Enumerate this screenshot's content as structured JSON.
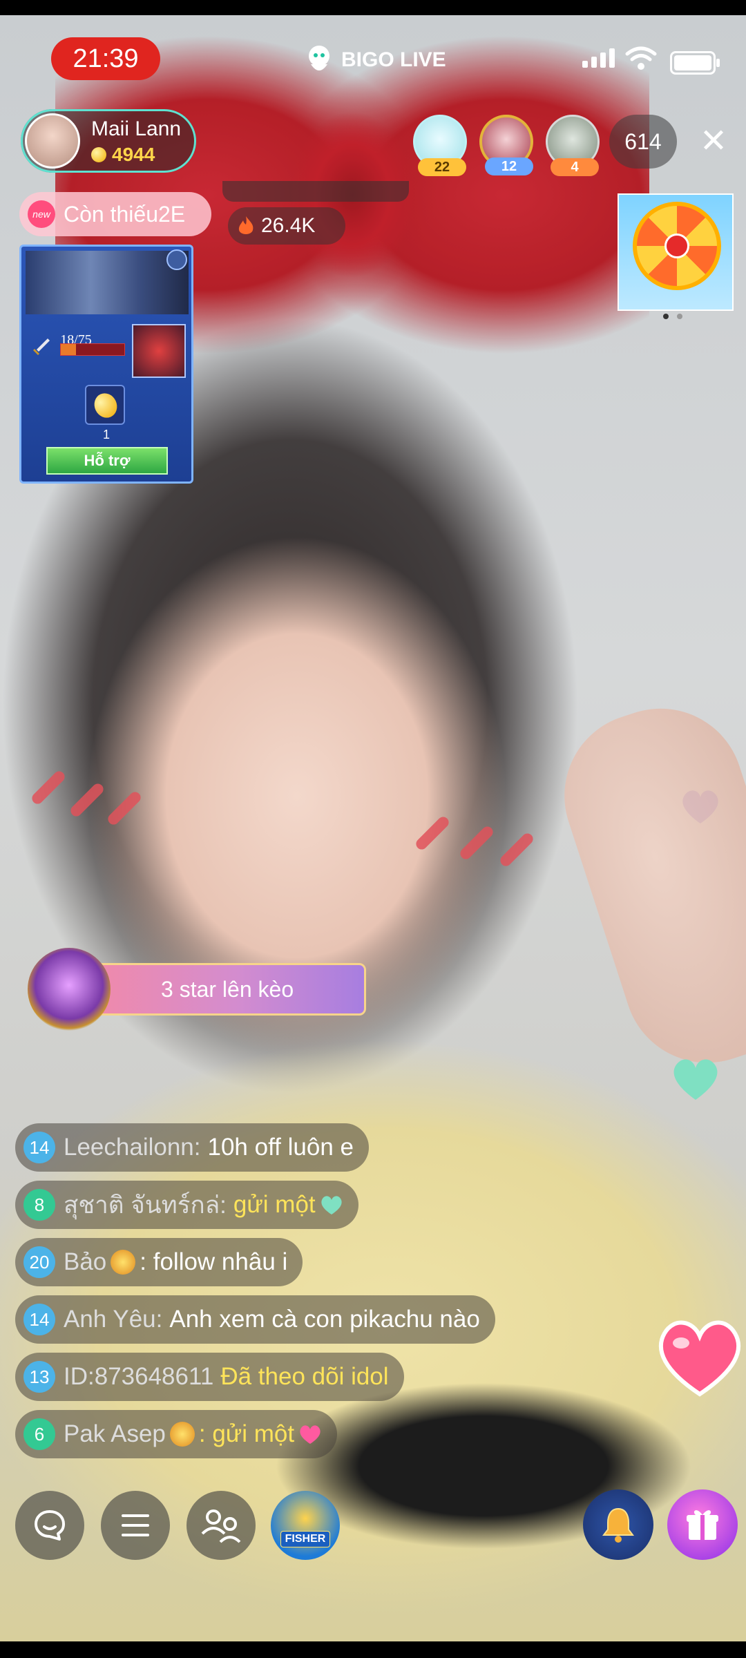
{
  "app": {
    "brand": "BIGO LIVE"
  },
  "status_bar": {
    "time": "21:39"
  },
  "host": {
    "name": "Maii Lann",
    "beans": "4944"
  },
  "mission": {
    "badge": "new",
    "text": "Còn thiếu2E"
  },
  "stats": {
    "heat": "26.4K"
  },
  "viewers": [
    {
      "level": "22"
    },
    {
      "level": "12"
    },
    {
      "level": "4"
    }
  ],
  "viewer_count": "614",
  "game_widget": {
    "progress_text": "18/75",
    "progress": 0.24,
    "item_qty": "1",
    "help_label": "Hỗ trợ"
  },
  "banner": {
    "text": "3 star lên kèo"
  },
  "chat": [
    {
      "level": "14",
      "level_color": "blue",
      "user": "Leechailonn:",
      "text": "10h off luôn e",
      "text_style": "white"
    },
    {
      "level": "8",
      "level_color": "green",
      "user": "สุชาติ จันทร์กล่:",
      "text": "gửi một",
      "text_style": "gold",
      "icon": "mint-heart-icon"
    },
    {
      "level": "20",
      "level_color": "blue",
      "user": "Bảo",
      "badge": "shield-badge-icon",
      "text": ": follow nhâu i",
      "text_style": "white"
    },
    {
      "level": "14",
      "level_color": "blue",
      "user": "Anh Yêu:",
      "text": "Anh xem cà con pikachu nào",
      "text_style": "white"
    },
    {
      "level": "13",
      "level_color": "blue",
      "user": "ID:873648611",
      "text": "Đã theo dõi idol",
      "text_style": "gold"
    },
    {
      "level": "6",
      "level_color": "green",
      "user": "Pak Asep",
      "badge": "star-badge-icon",
      "text": ": gửi một",
      "text_style": "gold",
      "icon": "pink-heart-icon"
    }
  ],
  "colors": {
    "live_red": "#e0251f",
    "mint": "#5fe1d0",
    "gold_text": "#ffe45a",
    "level_blue": "#4cb3e8",
    "level_green": "#33c993"
  },
  "icons": {
    "chat_button": "chat-bubble-icon",
    "menu_button": "menu-icon",
    "multi_guest_button": "people-icon",
    "fisher_game": "FISHER",
    "bell_button": "bell-icon",
    "gift_button": "gift-icon",
    "like_button": "heart-icon"
  }
}
